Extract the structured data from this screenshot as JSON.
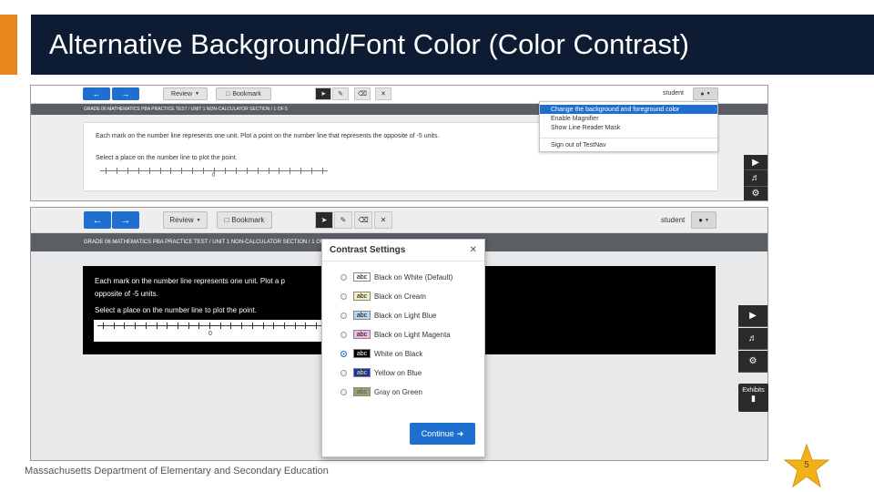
{
  "slide": {
    "title": "Alternative Background/Font Color (Color Contrast)",
    "footer": "Massachusetts Department of Elementary and Secondary Education",
    "page_number": "5",
    "colors": {
      "accent": "#e8861e",
      "title_band": "#0d1b33",
      "toolbar_blue": "#1f6fd1"
    }
  },
  "toolbar": {
    "back_icon": "arrow-left-icon",
    "forward_icon": "arrow-right-icon",
    "review_label": "Review",
    "bookmark_label": "Bookmark",
    "user_label": "student",
    "tools": [
      "pointer-icon",
      "highlighter-icon",
      "eraser-icon",
      "strikethrough-icon"
    ]
  },
  "breadcrumb": {
    "top": "GRADE 06 MATHEMATICS PBA PRACTICE TEST / UNIT 1 NON-CALCULATOR SECTION / 1 OF 5",
    "bottom": "GRADE 06 MATHEMATICS PBA PRACTICE TEST / UNIT 1 NON-CALCULATOR SECTION / 1 OF 5"
  },
  "question": {
    "text_full": "Each mark on the number line represents one unit. Plot a point on the number line that represents the opposite of -5 units.",
    "text_part1": "Each mark on the number line represents one unit. Plot a p",
    "text_part2": "opposite of -5 units.",
    "instruction": "Select a place on the number line to plot the point.",
    "origin_label": "0"
  },
  "user_menu": {
    "items": [
      {
        "label": "Change the background and foreground color",
        "highlighted": true
      },
      {
        "label": "Enable Magnifier",
        "highlighted": false
      },
      {
        "label": "Show Line Reader Mask",
        "highlighted": false
      }
    ],
    "sign_out": "Sign out of TestNav"
  },
  "contrast_modal": {
    "title": "Contrast Settings",
    "close_icon": "close-icon",
    "swatch_text": "abc",
    "options": [
      {
        "label": "Black on White (Default)",
        "bg": "#ffffff",
        "fg": "#000000",
        "selected": false
      },
      {
        "label": "Black on Cream",
        "bg": "#f6efc4",
        "fg": "#000000",
        "selected": false
      },
      {
        "label": "Black on Light Blue",
        "bg": "#b9d8f2",
        "fg": "#000000",
        "selected": false
      },
      {
        "label": "Black on Light Magenta",
        "bg": "#f2b6e8",
        "fg": "#000000",
        "selected": false
      },
      {
        "label": "White on Black",
        "bg": "#000000",
        "fg": "#ffffff",
        "selected": true
      },
      {
        "label": "Yellow on Blue",
        "bg": "#1c2fb3",
        "fg": "#ffff00",
        "selected": false
      },
      {
        "label": "Gray on Green",
        "bg": "#9aa36a",
        "fg": "#555555",
        "selected": false
      }
    ],
    "continue_label": "Continue"
  },
  "side_rail": {
    "icons": [
      "play-icon",
      "speaker-icon",
      "gear-icon"
    ],
    "exhibits_label": "Exhibits",
    "exhibits_icon": "folder-icon"
  }
}
